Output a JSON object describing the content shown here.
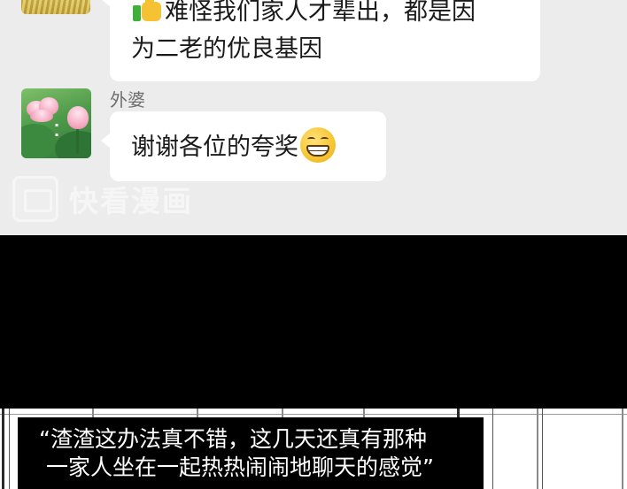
{
  "chat": {
    "messages": [
      {
        "lines": [
          "难怪我们家人才辈出，都是因",
          "为二老的优良基因"
        ],
        "leading_icon": "thumbs-up-icon"
      },
      {
        "sender": "外婆",
        "text": "谢谢各位的夸奖",
        "trailing_icon": "grinning-face-icon"
      }
    ],
    "watermark": "快看漫画"
  },
  "caption": {
    "line1": "“渣渣这办法真不错，这几天还真有那种",
    "line2": "一家人坐在一起热热闹闹地聊天的感觉”"
  },
  "colors": {
    "chat_background": "#ececec",
    "bubble": "#ffffff",
    "band": "#000000",
    "caption_box": "#000000",
    "caption_text": "#ffffff"
  }
}
